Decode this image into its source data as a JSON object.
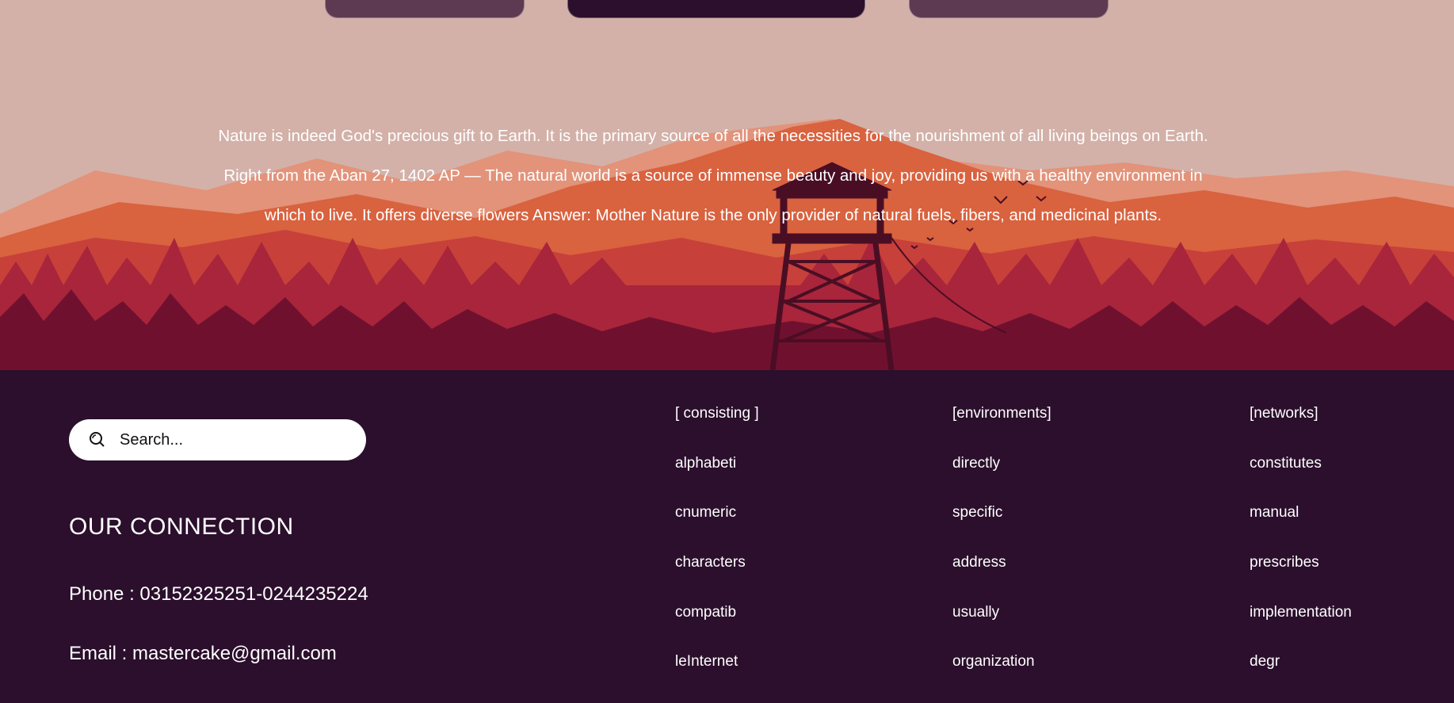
{
  "hero": {
    "paragraph": "Nature is indeed God's precious gift to Earth. It is the primary source of all the necessities for the nourishment of all living beings on Earth. Right from the Aban 27, 1402 AP — The natural world is a source of immense beauty and joy, providing us with a healthy environment in which to live. It offers diverse flowers Answer: Mother Nature is the only provider of natural fuels, fibers, and medicinal plants."
  },
  "search": {
    "placeholder": "Search..."
  },
  "connection": {
    "title": "OUR CONNECTION",
    "phone": "Phone : 03152325251-0244235224",
    "email": "Email : mastercake@gmail.com"
  },
  "links": {
    "col1": [
      "[ consisting ]",
      "alphabeti",
      "cnumeric",
      "characters",
      "compatib",
      "leInternet"
    ],
    "col2": [
      "[environments]",
      "directly",
      "specific",
      "address",
      "usually",
      "organization"
    ],
    "col3": [
      "[networks]",
      "constitutes",
      "manual",
      "prescribes",
      "implementation",
      "degr"
    ]
  },
  "colors": {
    "footer_bg": "#2b0f2c",
    "sky": "#d3b1a8",
    "mountain_far": "#e0876a",
    "mountain_mid": "#d8573c",
    "forest": "#a8243a",
    "forest_dark": "#6e0f30"
  }
}
